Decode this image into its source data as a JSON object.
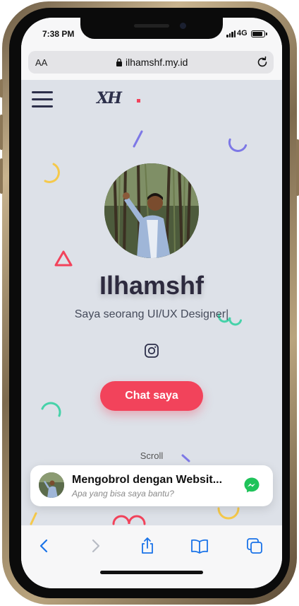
{
  "status_bar": {
    "time": "7:38 PM",
    "network": "4G"
  },
  "browser": {
    "text_size_label": "AA",
    "domain": "ilhamshf.my.id"
  },
  "site": {
    "logo": "XH",
    "name": "Ilhamshf",
    "tagline": "Saya seorang UI/UX Designer|",
    "cta_label": "Chat saya",
    "scroll_label": "Scroll"
  },
  "chat_widget": {
    "title": "Mengobrol dengan Websit...",
    "subtitle": "Apa yang bisa saya bantu?"
  },
  "colors": {
    "accent": "#f2435b",
    "background": "#dde1e8",
    "heading": "#2d2a3e",
    "deco_yellow": "#f5c94b",
    "deco_purple": "#7d78e6",
    "deco_teal": "#46d2a9",
    "deco_red": "#f2435b"
  },
  "icons": [
    "menu-icon",
    "lock-icon",
    "reload-icon",
    "instagram-icon",
    "messenger-icon",
    "back-icon",
    "forward-icon",
    "share-icon",
    "bookmarks-icon",
    "tabs-icon"
  ]
}
